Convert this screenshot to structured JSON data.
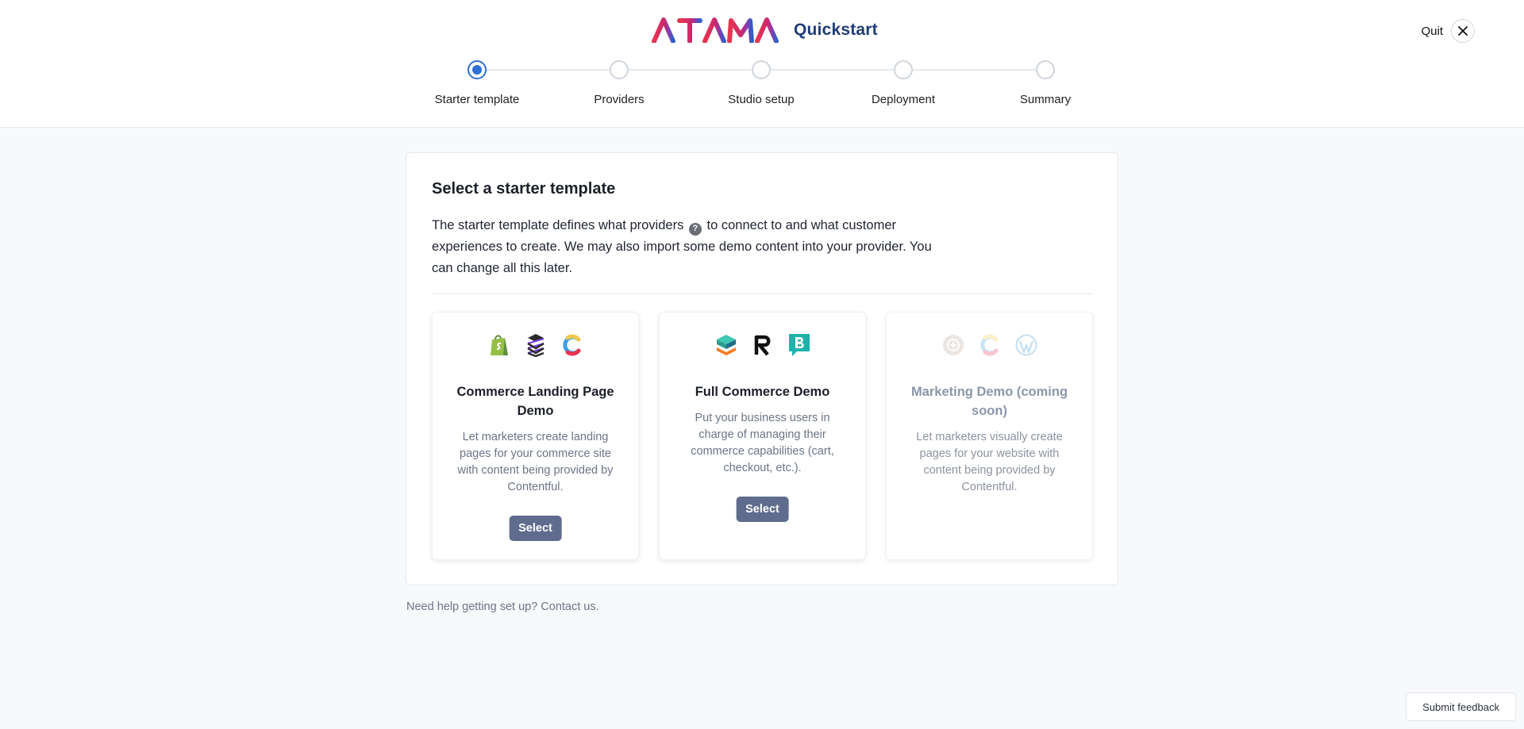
{
  "header": {
    "brand_name": "ATAMA",
    "title": "Quickstart",
    "quit_label": "Quit",
    "brand_colors": [
      "#e8354f",
      "#c92a6e",
      "#7f3fb5",
      "#2f5fc4"
    ]
  },
  "stepper": {
    "active_index": 0,
    "accent": "#2f6fd6",
    "steps": [
      {
        "label": "Starter template"
      },
      {
        "label": "Providers"
      },
      {
        "label": "Studio setup"
      },
      {
        "label": "Deployment"
      },
      {
        "label": "Summary"
      }
    ]
  },
  "main": {
    "title": "Select a starter template",
    "desc_part1": "The starter template defines what providers",
    "desc_help_glyph": "?",
    "desc_part2": "to connect to and what customer experiences to create. We may also import some demo content into your provider. You can change all this later.",
    "templates": [
      {
        "title": "Commerce Landing Page Demo",
        "description": "Let marketers create landing pages for your commerce site with content being provided by Contentful.",
        "button": "Select",
        "icons": [
          "shopify-icon",
          "layered-stack-icon",
          "contentful-icon"
        ]
      },
      {
        "title": "Full Commerce Demo",
        "description": "Put your business users in charge of managing their commerce capabilities (cart, checkout, etc.).",
        "button": "Select",
        "icons": [
          "commercetools-icon",
          "r-logo-icon",
          "bigcommerce-icon"
        ]
      },
      {
        "title": "Marketing Demo (coming soon)",
        "description": "Let marketers visually create pages for your website with content being provided by Contentful.",
        "icons": [
          "circle-logo-icon",
          "contentful-icon",
          "wordpress-icon"
        ]
      }
    ],
    "help_text": "Need help getting set up? Contact us."
  },
  "footer": {
    "feedback_label": "Submit feedback"
  }
}
